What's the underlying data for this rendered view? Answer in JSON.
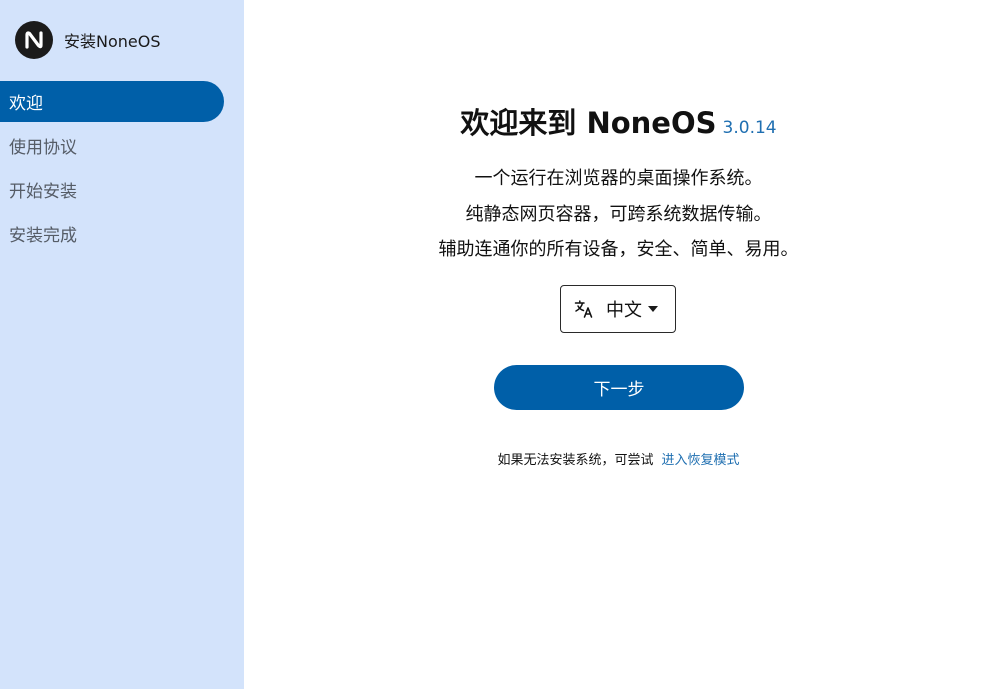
{
  "app": {
    "title": "安装NoneOS"
  },
  "sidebar": {
    "items": [
      {
        "label": "欢迎",
        "active": true
      },
      {
        "label": "使用协议",
        "active": false
      },
      {
        "label": "开始安装",
        "active": false
      },
      {
        "label": "安装完成",
        "active": false
      }
    ]
  },
  "main": {
    "title": "欢迎来到 NoneOS",
    "version": "3.0.14",
    "description": [
      "一个运行在浏览器的桌面操作系统。",
      "纯静态网页容器，可跨系统数据传输。",
      "辅助连通你的所有设备，安全、简单、易用。"
    ],
    "language": {
      "icon": "translate-icon",
      "selected": "中文"
    },
    "next_button": "下一步",
    "hint_text": "如果无法安装系统，可尝试",
    "hint_link": "进入恢复模式"
  },
  "colors": {
    "sidebar_bg": "#d3e3fb",
    "accent": "#005fa8",
    "link": "#1f6fb1"
  }
}
